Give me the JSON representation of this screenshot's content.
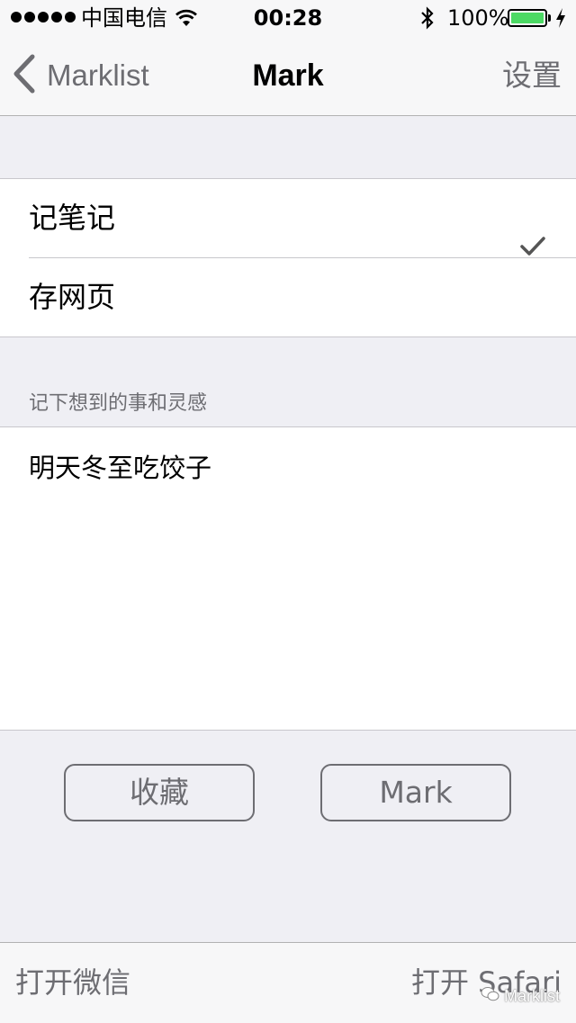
{
  "status_bar": {
    "carrier": "中国电信",
    "time": "00:28",
    "battery": "100%",
    "battery_level": 1.0,
    "icons": [
      "signal-dots-icon",
      "wifi-icon",
      "bluetooth-icon",
      "battery-icon",
      "charging-bolt-icon"
    ]
  },
  "nav": {
    "back_label": "Marklist",
    "title": "Mark",
    "settings_label": "设置",
    "icons": [
      "chevron-left-icon"
    ]
  },
  "options": [
    {
      "label": "记笔记",
      "selected": true
    },
    {
      "label": "存网页",
      "selected": false
    }
  ],
  "note": {
    "section_header": "记下想到的事和灵感",
    "text": "明天冬至吃饺子"
  },
  "buttons": {
    "favorite_label": "收藏",
    "mark_label": "Mark"
  },
  "toolbar": {
    "open_wechat_label": "打开微信",
    "open_safari_label": "打开 Safari"
  },
  "watermark": {
    "text": "Marklist",
    "icon": "wechat-icon"
  },
  "colors": {
    "background": "#efeff4",
    "bar": "#f7f7f8",
    "secondary_text": "#6d6d72",
    "battery_green": "#4cd964"
  }
}
